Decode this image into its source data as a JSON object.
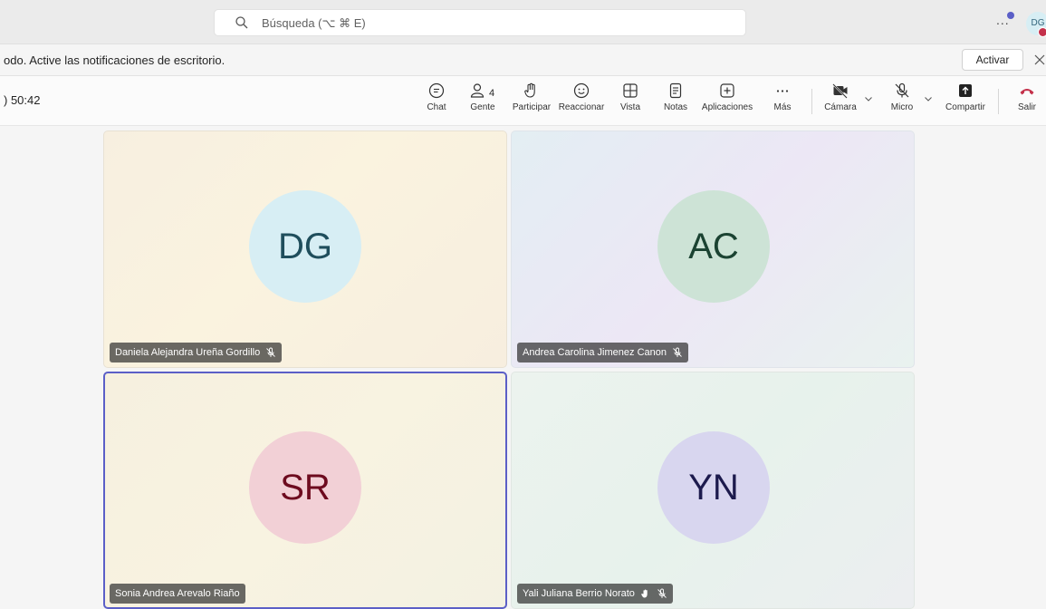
{
  "topbar": {
    "search_placeholder": "Búsqueda (⌥ ⌘ E)",
    "more": "...",
    "user_initials": "DG"
  },
  "notification": {
    "message": "odo. Active las notificaciones de escritorio.",
    "activate_label": "Activar"
  },
  "meeting": {
    "timer": ") 50:42",
    "people_count": "4",
    "toolbar": {
      "chat": "Chat",
      "people": "Gente",
      "raise_hand": "Participar",
      "react": "Reaccionar",
      "view": "Vista",
      "notes": "Notas",
      "apps": "Aplicaciones",
      "more": "Más",
      "camera": "Cámara",
      "mic": "Micro",
      "share": "Compartir",
      "leave": "Salir"
    }
  },
  "participants": [
    {
      "initials": "DG",
      "name": "Daniela Alejandra Ureña Gordillo",
      "muted": true,
      "avatar_bg": "#d7eef4",
      "avatar_fg": "#1f4e5c"
    },
    {
      "initials": "AC",
      "name": "Andrea Carolina Jimenez Canon",
      "muted": true,
      "avatar_bg": "#cde3d6",
      "avatar_fg": "#1b4332"
    },
    {
      "initials": "SR",
      "name": "Sonia Andrea Arevalo Riaño",
      "muted": false,
      "avatar_bg": "#f2d0d6",
      "avatar_fg": "#6e0b1f"
    },
    {
      "initials": "YN",
      "name": "Yali Juliana Berrio Norato",
      "muted": true,
      "avatar_bg": "#d8d6ef",
      "avatar_fg": "#1c1a4d"
    }
  ],
  "colors": {
    "accent": "#5b5fc7",
    "leave": "#c4314b"
  }
}
